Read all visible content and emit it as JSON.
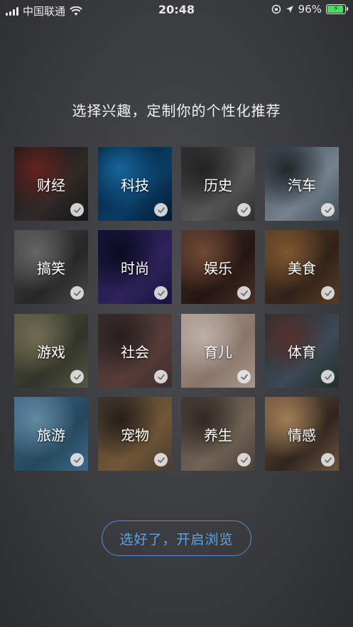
{
  "status_bar": {
    "carrier": "中国联通",
    "time": "20:48",
    "battery": "96%"
  },
  "heading": "选择兴趣，定制你的个性化推荐",
  "interests": [
    {
      "label": "财经",
      "selected": true,
      "icon": "finance-chart-image",
      "colors": [
        "#1a1c1f",
        "#3b3330",
        "#7a2a24"
      ]
    },
    {
      "label": "科技",
      "selected": true,
      "icon": "tech-network-image",
      "colors": [
        "#07203d",
        "#0c4a7a",
        "#1b7dbf"
      ]
    },
    {
      "label": "历史",
      "selected": true,
      "icon": "history-statues-image",
      "colors": [
        "#3a3a3a",
        "#6a6a6a",
        "#2a2a2a"
      ]
    },
    {
      "label": "汽车",
      "selected": true,
      "icon": "car-image",
      "colors": [
        "#4c5e6c",
        "#8fa0ac",
        "#2b2f33"
      ]
    },
    {
      "label": "搞笑",
      "selected": true,
      "icon": "funny-people-image",
      "colors": [
        "#5a5a5a",
        "#2f2f2f",
        "#7c7c7c"
      ]
    },
    {
      "label": "时尚",
      "selected": true,
      "icon": "fashion-image",
      "colors": [
        "#1a1b4a",
        "#3a2b6e",
        "#0d0f2a"
      ]
    },
    {
      "label": "娱乐",
      "selected": true,
      "icon": "entertainment-image",
      "colors": [
        "#5a3a30",
        "#2c1b17",
        "#8a5a3f"
      ]
    },
    {
      "label": "美食",
      "selected": true,
      "icon": "food-image",
      "colors": [
        "#6b4a2e",
        "#3b2a1e",
        "#9a6a3a"
      ]
    },
    {
      "label": "游戏",
      "selected": true,
      "icon": "game-tank-image",
      "colors": [
        "#6a6a50",
        "#3c3f33",
        "#8a8565"
      ]
    },
    {
      "label": "社会",
      "selected": true,
      "icon": "society-street-image",
      "colors": [
        "#4a3a3a",
        "#6b4a45",
        "#2e2626"
      ]
    },
    {
      "label": "育儿",
      "selected": true,
      "icon": "parenting-baby-image",
      "colors": [
        "#cdb8aa",
        "#a89080",
        "#e6d6cc"
      ]
    },
    {
      "label": "体育",
      "selected": true,
      "icon": "sports-football-image",
      "colors": [
        "#2a3a2e",
        "#4a5a6a",
        "#6a3a3a"
      ]
    },
    {
      "label": "旅游",
      "selected": true,
      "icon": "travel-temple-image",
      "colors": [
        "#4a7fa6",
        "#2d5870",
        "#7aa7c4"
      ]
    },
    {
      "label": "宠物",
      "selected": true,
      "icon": "pet-dog-image",
      "colors": [
        "#5a4a3e",
        "#8a6a42",
        "#2e2620"
      ]
    },
    {
      "label": "养生",
      "selected": true,
      "icon": "health-tea-image",
      "colors": [
        "#5a4e44",
        "#8a7a68",
        "#3a322c"
      ]
    },
    {
      "label": "情感",
      "selected": true,
      "icon": "emotion-couple-image",
      "colors": [
        "#8a6a4e",
        "#3a2e26",
        "#c49a6a"
      ]
    }
  ],
  "cta_button": "选好了，开启浏览",
  "accent_color": "#4a90d9"
}
